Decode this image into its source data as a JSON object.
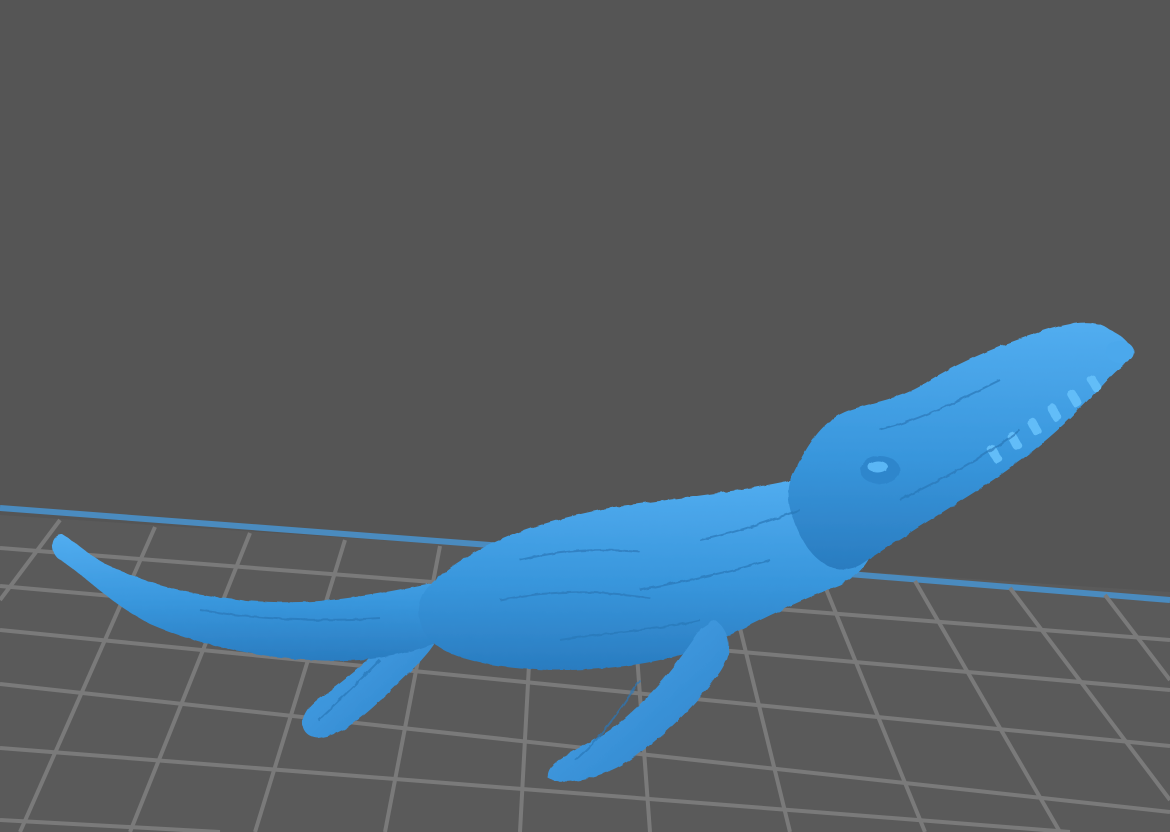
{
  "viewer": {
    "background_color": "#555555",
    "plate_line_color": "#7a7a7a",
    "plate_edge_color": "#4a8bbf",
    "model": {
      "name": "mosasaur-model",
      "color": "#3d9ae0"
    }
  }
}
